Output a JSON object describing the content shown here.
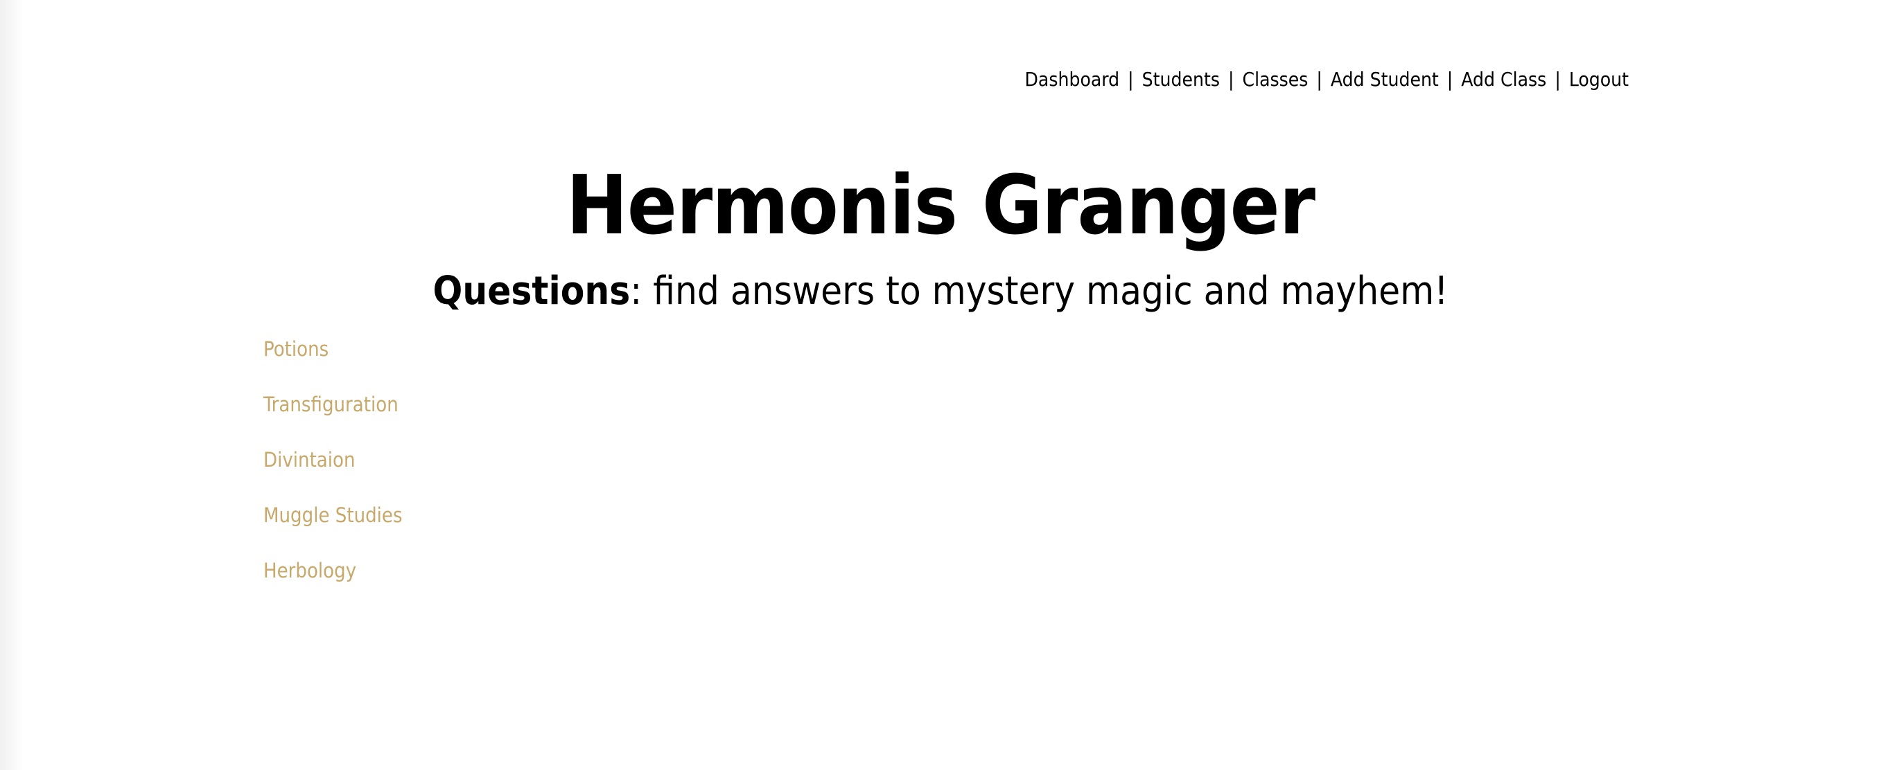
{
  "nav": {
    "items": [
      {
        "label": "Dashboard"
      },
      {
        "label": "Students"
      },
      {
        "label": "Classes"
      },
      {
        "label": "Add Student"
      },
      {
        "label": "Add Class"
      },
      {
        "label": "Logout"
      }
    ],
    "separator": "|"
  },
  "header": {
    "title": "Hermonis Granger",
    "subtitle_bold": "Questions",
    "subtitle_rest": ": find answers to mystery magic and mayhem!"
  },
  "sidebar": {
    "items": [
      {
        "label": "Potions"
      },
      {
        "label": "Transfiguration"
      },
      {
        "label": "Divintaion"
      },
      {
        "label": "Muggle Studies"
      },
      {
        "label": "Herbology"
      }
    ]
  },
  "colors": {
    "sidebar_link": "#c6a96b",
    "text": "#000000",
    "background": "#ffffff"
  }
}
